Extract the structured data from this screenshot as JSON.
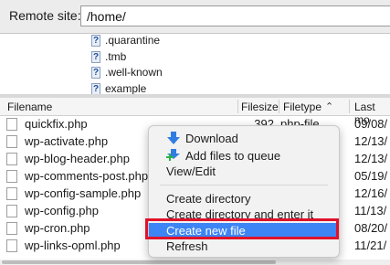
{
  "remote_site": {
    "label": "Remote site:",
    "value": "/home/"
  },
  "tree": {
    "items": [
      ".quarantine",
      ".tmb",
      ".well-known",
      "example"
    ]
  },
  "table": {
    "columns": {
      "filename": "Filename",
      "filesize": "Filesize",
      "filetype": "Filetype",
      "last_modified": "Last mo"
    },
    "rows": [
      {
        "name": "quickfix.php",
        "size": "392",
        "type": "php-file",
        "date": "09/08/"
      },
      {
        "name": "wp-activate.php",
        "size": "",
        "type": "",
        "date": "12/13/"
      },
      {
        "name": "wp-blog-header.php",
        "size": "",
        "type": "",
        "date": "12/13/"
      },
      {
        "name": "wp-comments-post.php",
        "size": "",
        "type": "",
        "date": "05/19/"
      },
      {
        "name": "wp-config-sample.php",
        "size": "",
        "type": "",
        "date": "12/16/"
      },
      {
        "name": "wp-config.php",
        "size": "",
        "type": "",
        "date": "11/13/"
      },
      {
        "name": "wp-cron.php",
        "size": "",
        "type": "",
        "date": "08/20/"
      },
      {
        "name": "wp-links-opml.php",
        "size": "",
        "type": "",
        "date": "11/21/"
      }
    ]
  },
  "context_menu": {
    "download": "Download",
    "add_to_queue": "Add files to queue",
    "view_edit": "View/Edit",
    "create_directory": "Create directory",
    "create_directory_enter": "Create directory and enter it",
    "create_new_file": "Create new file",
    "refresh": "Refresh"
  },
  "colors": {
    "highlight": "#3d85f5",
    "annotation_box": "#e0112a",
    "icon_blue": "#2f7de1",
    "icon_green": "#2bb24c"
  }
}
